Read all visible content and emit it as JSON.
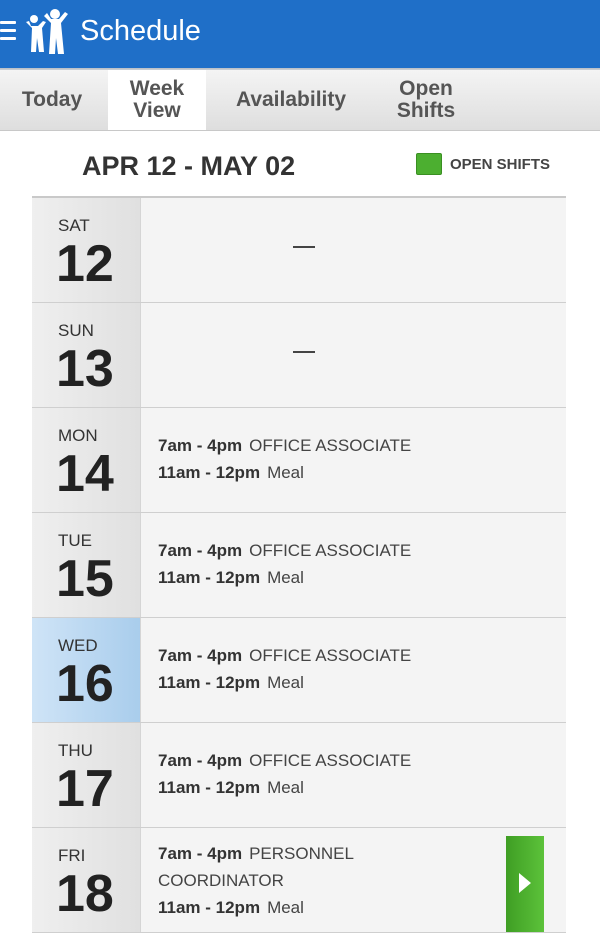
{
  "app": {
    "title": "Schedule"
  },
  "tabs": [
    {
      "label": "Today"
    },
    {
      "label": "Week\nView"
    },
    {
      "label": "Availability"
    },
    {
      "label": "Open\nShifts"
    }
  ],
  "active_tab_index": 1,
  "range": {
    "title": "APR 12 - MAY 02"
  },
  "legend": {
    "label": "OPEN SHIFTS",
    "color": "#4caf30"
  },
  "days": [
    {
      "dow": "SAT",
      "dom": "12",
      "empty_marker": "—"
    },
    {
      "dow": "SUN",
      "dom": "13",
      "empty_marker": "—"
    },
    {
      "dow": "MON",
      "dom": "14",
      "shifts": [
        {
          "time": "7am - 4pm",
          "role": "OFFICE ASSOCIATE"
        },
        {
          "time": "11am - 12pm",
          "role": "Meal"
        }
      ]
    },
    {
      "dow": "TUE",
      "dom": "15",
      "shifts": [
        {
          "time": "7am - 4pm",
          "role": "OFFICE ASSOCIATE"
        },
        {
          "time": "11am - 12pm",
          "role": "Meal"
        }
      ]
    },
    {
      "dow": "WED",
      "dom": "16",
      "today": true,
      "shifts": [
        {
          "time": "7am - 4pm",
          "role": "OFFICE ASSOCIATE"
        },
        {
          "time": "11am - 12pm",
          "role": "Meal"
        }
      ]
    },
    {
      "dow": "THU",
      "dom": "17",
      "shifts": [
        {
          "time": "7am - 4pm",
          "role": "OFFICE ASSOCIATE"
        },
        {
          "time": "11am - 12pm",
          "role": "Meal"
        }
      ]
    },
    {
      "dow": "FRI",
      "dom": "18",
      "shifts": [
        {
          "time": "7am - 4pm",
          "role": "PERSONNEL"
        },
        {
          "time": "",
          "role": "COORDINATOR"
        },
        {
          "time": "11am - 12pm",
          "role": "Meal"
        }
      ],
      "has_open_shift": true
    }
  ],
  "colors": {
    "appbar": "#1f6fc8",
    "today_highlight": "#a9cdec",
    "open_shift": "#4caf30"
  }
}
